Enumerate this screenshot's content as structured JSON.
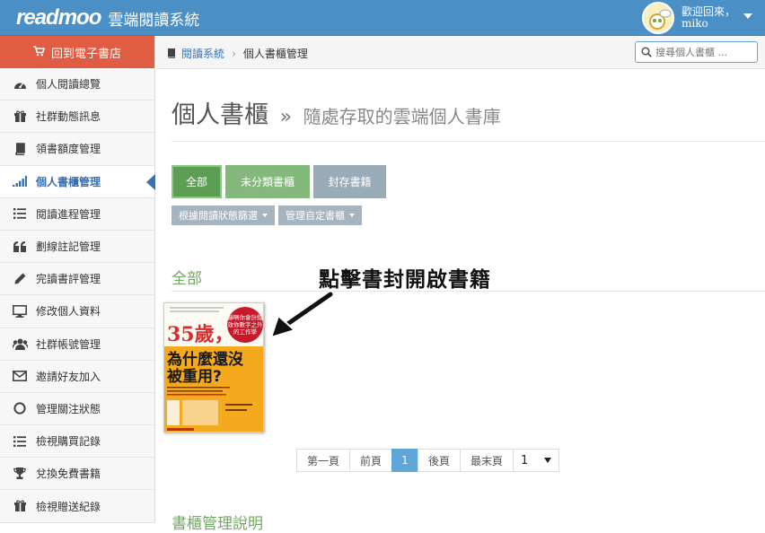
{
  "header": {
    "logo_text": "readmoo",
    "system_name": "雲端閱讀系統",
    "welcome": "歡迎回來，",
    "username": "miko"
  },
  "sidebar": {
    "store_button": "回到電子書店",
    "items": [
      {
        "label": "個人閱讀總覽",
        "icon": "dashboard-icon"
      },
      {
        "label": "社群動態訊息",
        "icon": "gift-icon"
      },
      {
        "label": "領書額度管理",
        "icon": "book-icon"
      },
      {
        "label": "個人書櫃管理",
        "icon": "signal-bars-icon",
        "active": true
      },
      {
        "label": "閱讀進程管理",
        "icon": "list-icon"
      },
      {
        "label": "劃線註記管理",
        "icon": "quote-icon"
      },
      {
        "label": "完讀書評管理",
        "icon": "pencil-icon"
      },
      {
        "label": "修改個人資料",
        "icon": "monitor-icon"
      },
      {
        "label": "社群帳號管理",
        "icon": "users-icon"
      },
      {
        "label": "邀請好友加入",
        "icon": "envelope-icon"
      },
      {
        "label": "管理關注狀態",
        "icon": "circle-icon"
      },
      {
        "label": "檢視購買記錄",
        "icon": "list-icon"
      },
      {
        "label": "兌換免費書籍",
        "icon": "trophy-icon"
      },
      {
        "label": "檢視贈送紀錄",
        "icon": "gift-icon"
      }
    ]
  },
  "breadcrumb": {
    "home": "閱讀系統",
    "current": "個人書櫃管理"
  },
  "search": {
    "placeholder": "搜尋個人書櫃 ..."
  },
  "page": {
    "title": "個人書櫃",
    "separator": "»",
    "subtitle": "隨處存取的雲端個人書庫"
  },
  "tabs": {
    "all": "全部",
    "uncategorized": "未分類書櫃",
    "archived": "封存書籍"
  },
  "filters": {
    "by_status": "根據閱讀狀態篩選",
    "custom_shelves": "管理自定書櫃"
  },
  "section_title": "全部",
  "annotation": "點擊書封開啟書籍",
  "book": {
    "title_number": "35歲，",
    "title_main": "為什麼還沒被重用？",
    "badge": "靜啊你會計錯 效你數字之外 的工作學"
  },
  "pagination": {
    "first": "第一頁",
    "prev": "前頁",
    "current": "1",
    "next": "後頁",
    "last": "最末頁",
    "select_value": "1"
  },
  "footer_title": "書櫃管理說明"
}
